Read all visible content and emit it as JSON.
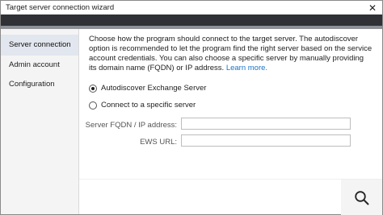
{
  "window": {
    "title": "Target server connection wizard",
    "close_glyph": "✕"
  },
  "sidebar": {
    "items": [
      {
        "label": "Server connection",
        "active": true
      },
      {
        "label": "Admin account",
        "active": false
      },
      {
        "label": "Configuration",
        "active": false
      }
    ]
  },
  "main": {
    "description": "Choose how the program should connect to the target server. The autodiscover option is recommended to let the program find the right server based on the service account credentials. You can also choose a specific server by manually providing its domain name (FQDN) or IP address.",
    "learn_more": "Learn more.",
    "options": [
      {
        "label": "Autodiscover Exchange Server",
        "checked": true
      },
      {
        "label": "Connect to a specific server",
        "checked": false
      }
    ],
    "fields": {
      "fqdn": {
        "label": "Server FQDN / IP address:",
        "value": ""
      },
      "ews": {
        "label": "EWS URL:",
        "value": ""
      }
    }
  },
  "footer": {
    "search_icon": "search-icon"
  },
  "colors": {
    "header_band": "#2f3137",
    "header_accent": "#8e9097",
    "sidebar_bg": "#f4f4f4",
    "active_item_bg": "#e2e6ee",
    "link": "#1a73c9"
  }
}
